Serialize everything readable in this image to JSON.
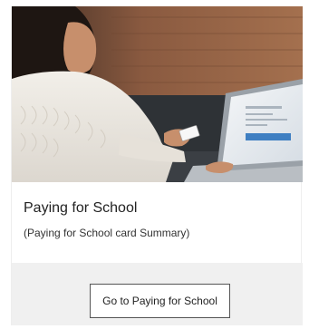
{
  "card": {
    "image_alt": "Woman using a credit card while shopping on a laptop",
    "title": "Paying for School",
    "summary": "(Paying for School card Summary)",
    "cta_label": "Go to Paying for School"
  }
}
